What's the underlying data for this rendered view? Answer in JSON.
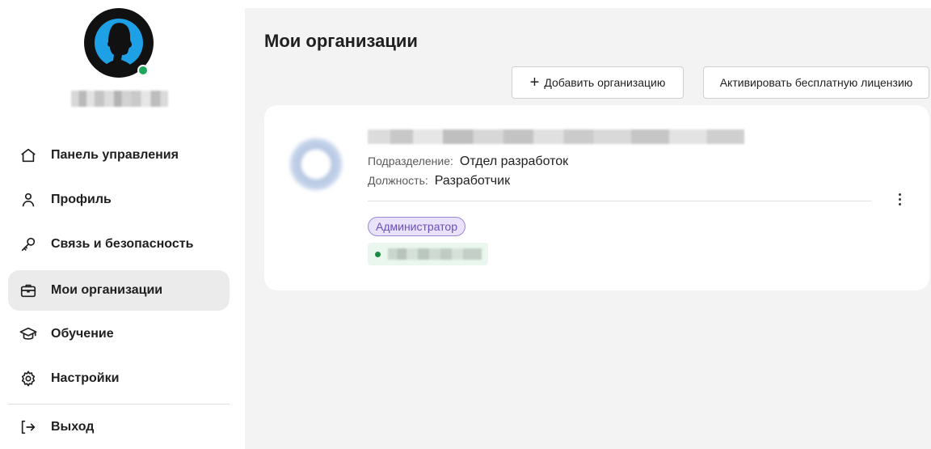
{
  "sidebar": {
    "user": {
      "name": "",
      "status": "online"
    },
    "items": [
      {
        "id": "dashboard",
        "label": "Панель управления",
        "icon": "home-icon",
        "active": false
      },
      {
        "id": "profile",
        "label": "Профиль",
        "icon": "user-icon",
        "active": false
      },
      {
        "id": "security",
        "label": "Связь и безопасность",
        "icon": "key-icon",
        "active": false
      },
      {
        "id": "organizations",
        "label": "Мои организации",
        "icon": "briefcase-icon",
        "active": true
      },
      {
        "id": "learning",
        "label": "Обучение",
        "icon": "graduation-cap-icon",
        "active": false
      },
      {
        "id": "settings",
        "label": "Настройки",
        "icon": "gear-icon",
        "active": false
      }
    ],
    "logout": {
      "label": "Выход",
      "icon": "logout-icon"
    }
  },
  "main": {
    "title": "Мои организации",
    "actions": {
      "add_label": "Добавить организацию",
      "license_label": "Активировать бесплатную лицензию"
    },
    "organizations": [
      {
        "name": "",
        "department_key": "Подразделение:",
        "department_value": "Отдел разработок",
        "position_key": "Должность:",
        "position_value": "Разработчик",
        "role": "Администратор",
        "status_text": ""
      }
    ]
  },
  "colors": {
    "accent_avatar": "#1ea0e6",
    "online": "#1ea85a",
    "role_badge_bg": "#e9e2fb",
    "role_badge_text": "#6a4fb8",
    "status_bg": "#e9f7ee"
  }
}
